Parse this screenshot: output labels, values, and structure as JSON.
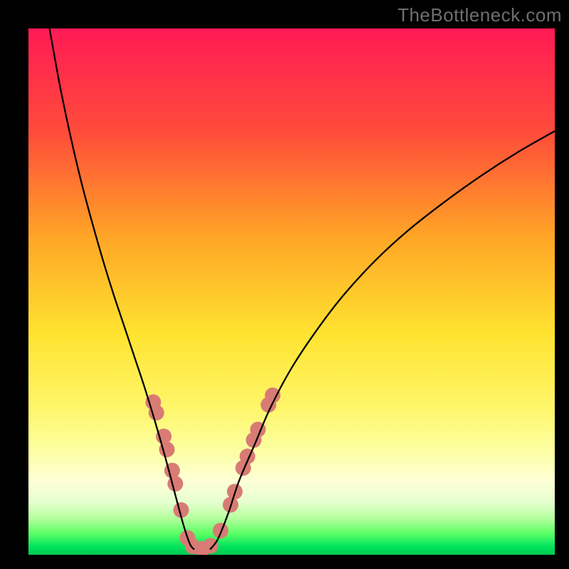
{
  "watermark": "TheBottleneck.com",
  "chart_data": {
    "type": "line",
    "title": "",
    "xlabel": "",
    "ylabel": "",
    "xlim": [
      0,
      100
    ],
    "ylim": [
      0,
      100
    ],
    "background_gradient_stops": [
      {
        "offset": 0.0,
        "color": "#ff1a55"
      },
      {
        "offset": 0.2,
        "color": "#ff4d3a"
      },
      {
        "offset": 0.4,
        "color": "#ffa726"
      },
      {
        "offset": 0.58,
        "color": "#ffe330"
      },
      {
        "offset": 0.72,
        "color": "#fff66a"
      },
      {
        "offset": 0.8,
        "color": "#fcffa0"
      },
      {
        "offset": 0.86,
        "color": "#feffd6"
      },
      {
        "offset": 0.9,
        "color": "#e6ffcf"
      },
      {
        "offset": 0.93,
        "color": "#b7ff9f"
      },
      {
        "offset": 0.96,
        "color": "#5bff65"
      },
      {
        "offset": 0.985,
        "color": "#00e35e"
      },
      {
        "offset": 1.0,
        "color": "#00c84f"
      }
    ],
    "series": [
      {
        "name": "left-branch",
        "stroke": "#000000",
        "stroke_width": 2.3,
        "x": [
          4,
          6,
          8,
          10,
          12,
          14,
          16,
          18,
          20,
          22,
          24,
          26,
          28,
          29.5,
          30.7,
          31.5
        ],
        "y": [
          100,
          89,
          79.5,
          71,
          63.5,
          56.5,
          50,
          44,
          38,
          32,
          25.5,
          18.5,
          11,
          5.5,
          2,
          1
        ]
      },
      {
        "name": "right-branch",
        "stroke": "#000000",
        "stroke_width": 2.3,
        "x": [
          34.5,
          36,
          38,
          40,
          43,
          46,
          50,
          55,
          60,
          66,
          72,
          79,
          86,
          93,
          100
        ],
        "y": [
          1,
          3,
          8,
          14,
          21,
          28,
          35.5,
          43,
          49.5,
          56,
          61.5,
          67,
          72,
          76.5,
          80.5
        ]
      },
      {
        "name": "valley-floor",
        "stroke": "#d87b74",
        "stroke_width": 10,
        "linecap": "round",
        "x": [
          30.2,
          31,
          32,
          33,
          34,
          35
        ],
        "y": [
          2.2,
          1.4,
          1.1,
          1.1,
          1.4,
          2.2
        ]
      }
    ],
    "markers": [
      {
        "x": 23.7,
        "y": 29.0
      },
      {
        "x": 24.3,
        "y": 27.0
      },
      {
        "x": 25.7,
        "y": 22.5
      },
      {
        "x": 26.3,
        "y": 20.0
      },
      {
        "x": 27.3,
        "y": 16.0
      },
      {
        "x": 27.9,
        "y": 13.5
      },
      {
        "x": 29.0,
        "y": 8.5
      },
      {
        "x": 30.2,
        "y": 3.2
      },
      {
        "x": 31.2,
        "y": 1.6
      },
      {
        "x": 33.0,
        "y": 1.1
      },
      {
        "x": 34.6,
        "y": 1.7
      },
      {
        "x": 36.5,
        "y": 4.6
      },
      {
        "x": 38.4,
        "y": 9.5
      },
      {
        "x": 39.2,
        "y": 12.0
      },
      {
        "x": 40.8,
        "y": 16.5
      },
      {
        "x": 41.6,
        "y": 18.7
      },
      {
        "x": 42.8,
        "y": 21.8
      },
      {
        "x": 43.6,
        "y": 23.8
      },
      {
        "x": 45.6,
        "y": 28.5
      },
      {
        "x": 46.4,
        "y": 30.3
      }
    ],
    "marker_style": {
      "r": 11,
      "fill": "#d87b74"
    }
  }
}
